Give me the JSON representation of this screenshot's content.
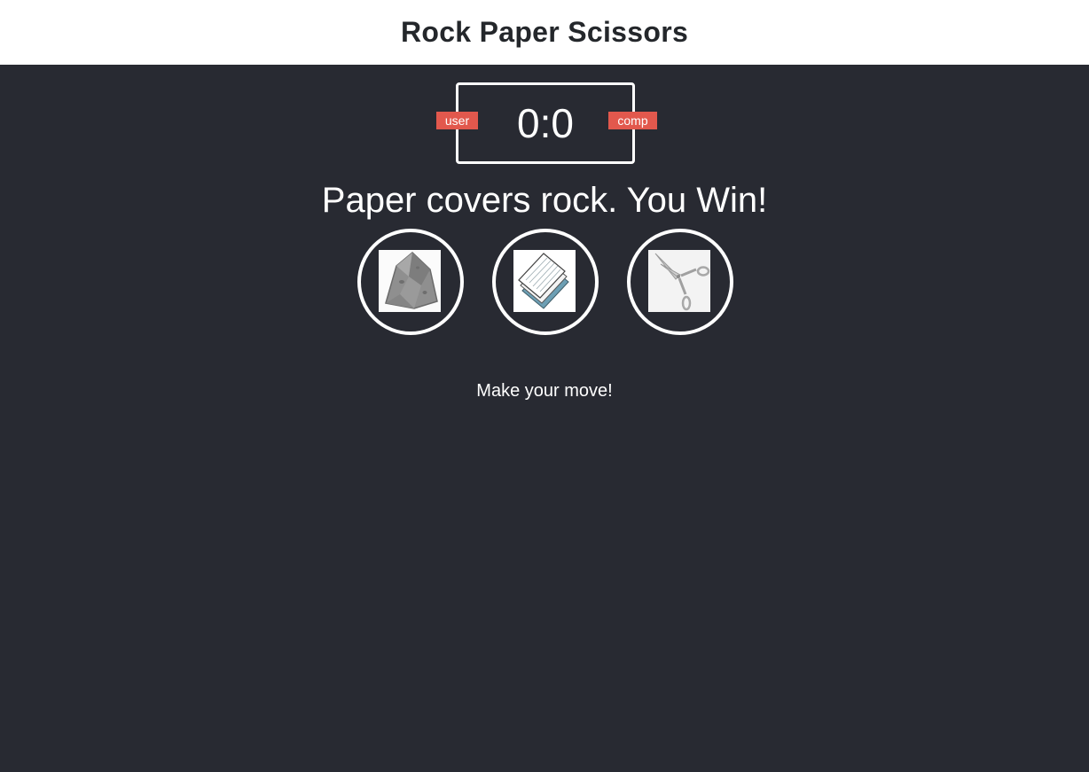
{
  "header": {
    "title": "Rock Paper Scissors"
  },
  "scoreboard": {
    "user_label": "user",
    "comp_label": "comp",
    "score": "0:0",
    "user_score": 0,
    "comp_score": 0
  },
  "result": {
    "text": "Paper covers rock. You Win!"
  },
  "choices": [
    {
      "id": "rock",
      "icon": "rock-icon"
    },
    {
      "id": "paper",
      "icon": "paper-icon"
    },
    {
      "id": "scissors",
      "icon": "scissors-icon"
    }
  ],
  "message": {
    "text": "Make your move!"
  },
  "colors": {
    "header_bg": "#ffffff",
    "page_bg": "#282a32",
    "badge_bg": "#e2584d",
    "text": "#ffffff",
    "title_text": "#24272b"
  }
}
